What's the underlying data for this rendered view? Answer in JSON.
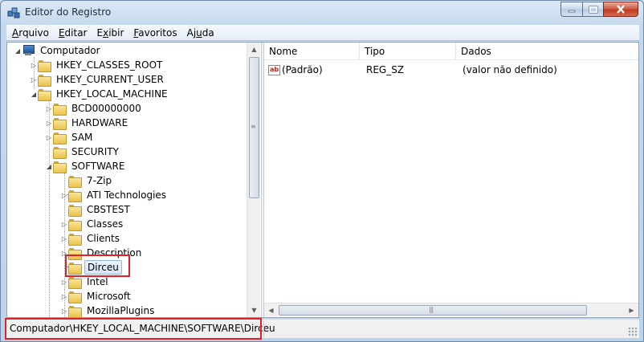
{
  "window": {
    "title": "Editor do Registro"
  },
  "menu": [
    {
      "label": "Arquivo",
      "mnemonic": "A",
      "rest": "rquivo"
    },
    {
      "label": "Editar",
      "mnemonic": "E",
      "rest": "ditar"
    },
    {
      "label": "Exibir",
      "mnemonic": "x",
      "pre": "E",
      "rest": "ibir"
    },
    {
      "label": "Favoritos",
      "mnemonic": "F",
      "rest": "avoritos"
    },
    {
      "label": "Ajuda",
      "pre": "Aj",
      "mnemonic": "u",
      "rest": "da"
    }
  ],
  "tree": {
    "root": "Computador",
    "hkey_classes_root": "HKEY_CLASSES_ROOT",
    "hkey_current_user": "HKEY_CURRENT_USER",
    "hkey_local_machine": "HKEY_LOCAL_MACHINE",
    "hklm_children": [
      "BCD00000000",
      "HARDWARE",
      "SAM",
      "SECURITY",
      "SOFTWARE"
    ],
    "software_children": [
      "7-Zip",
      "ATI Technologies",
      "CBSTEST",
      "Classes",
      "Clients",
      "Description",
      "Dirceu",
      "Intel",
      "Microsoft",
      "MozillaPlugins"
    ],
    "selected": "Dirceu"
  },
  "list": {
    "columns": [
      "Nome",
      "Tipo",
      "Dados"
    ],
    "rows": [
      {
        "name": "(Padrão)",
        "type": "REG_SZ",
        "data": "(valor não definido)",
        "icon": "string-value-icon"
      }
    ]
  },
  "status": {
    "path": "Computador\\HKEY_LOCAL_MACHINE\\SOFTWARE\\Dirceu"
  },
  "colors": {
    "highlight": "#e0202a",
    "selection": "#d4e6fb"
  }
}
